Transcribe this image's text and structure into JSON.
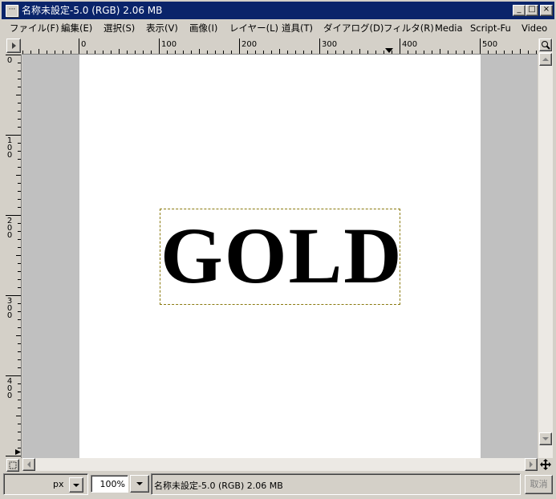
{
  "window": {
    "title": "名称未設定-5.0 (RGB) 2.06 MB",
    "icon": "ellipsis-icon",
    "controls": {
      "minimize": "_",
      "maximize": "□",
      "close": "×"
    }
  },
  "menu": {
    "items": [
      "ファイル(F)",
      "編集(E)",
      "選択(S)",
      "表示(V)",
      "画像(I)",
      "レイヤー(L)",
      "道具(T)",
      "ダイアログ(D)",
      "フィルタ(R)",
      "Media",
      "Script-Fu",
      "Video"
    ]
  },
  "ruler": {
    "horizontal_labels": [
      "0",
      "100",
      "200",
      "300",
      "400",
      "500"
    ],
    "vertical_labels": [
      "0",
      "100",
      "200",
      "300",
      "400"
    ]
  },
  "canvas": {
    "text": "GOLD",
    "background_color": "#ffffff",
    "padding_color": "#c0c0c0"
  },
  "status": {
    "unit": "px",
    "zoom": "100%",
    "info": "名称未設定-5.0 (RGB) 2.06 MB",
    "cancel_label": "取消"
  }
}
